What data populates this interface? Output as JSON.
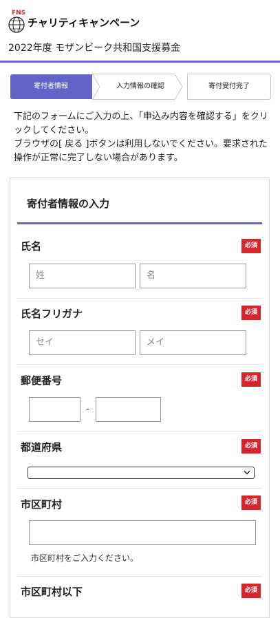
{
  "header": {
    "logo_small_text": "FNS",
    "logo_text": "チャリティキャンペーン",
    "campaign_title": "2022年度 モザンビーク共和国支援募金"
  },
  "steps": [
    {
      "label": "寄付者情報",
      "active": true
    },
    {
      "label": "入力情報の確認",
      "active": false
    },
    {
      "label": "寄付受付完了",
      "active": false
    }
  ],
  "intro": {
    "line1": "下記のフォームにご入力の上、「申込み内容を確認する」をクリックしてください。",
    "line2": "ブラウザの[ 戻る ]ボタンは利用しないでください。要求された操作が正常に完了しない場合があります。"
  },
  "form": {
    "section_title": "寄付者情報の入力",
    "required_badge": "必須",
    "name": {
      "label": "氏名",
      "last_placeholder": "姓",
      "first_placeholder": "名"
    },
    "kana": {
      "label": "氏名フリガナ",
      "last_placeholder": "セイ",
      "first_placeholder": "メイ"
    },
    "postal": {
      "label": "郵便番号",
      "separator": "-"
    },
    "prefecture": {
      "label": "都道府県",
      "selected": ""
    },
    "city": {
      "label": "市区町村",
      "help": "市区町村をご入力ください。"
    },
    "address": {
      "label": "市区町村以下"
    }
  },
  "colors": {
    "accent": "#6464c8",
    "required": "#d6262d",
    "step_inactive_border": "#c8c8c8"
  }
}
